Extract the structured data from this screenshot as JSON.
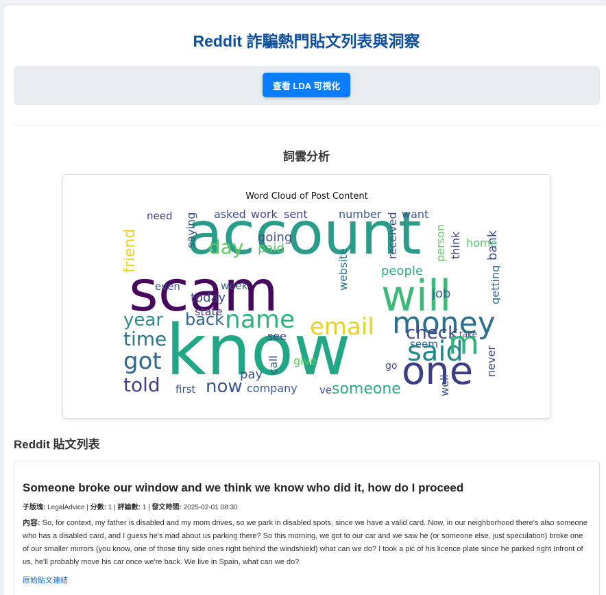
{
  "header": {
    "title": "Reddit 詐騙熱門貼文列表與洞察",
    "lda_button_label": "查看 LDA 可視化"
  },
  "wordcloud_section": {
    "title": "詞雲分析",
    "chart_title": "Word Cloud of Post Content",
    "words": [
      {
        "text": "account",
        "color": "#2a9d8a"
      },
      {
        "text": "know",
        "color": "#21a785"
      },
      {
        "text": "scam",
        "color": "#46085c"
      },
      {
        "text": "will",
        "color": "#40b87a"
      },
      {
        "text": "one",
        "color": "#3b3e84"
      },
      {
        "text": "money",
        "color": "#2a6f8e"
      },
      {
        "text": "email",
        "color": "#e4d22c"
      },
      {
        "text": "name",
        "color": "#2fb27c"
      },
      {
        "text": "said",
        "color": "#25868d"
      },
      {
        "text": "got",
        "color": "#31678e"
      },
      {
        "text": "told",
        "color": "#433d84"
      },
      {
        "text": "time",
        "color": "#2b768e"
      },
      {
        "text": "year",
        "color": "#2c8c8c"
      },
      {
        "text": "day",
        "color": "#5ec962"
      },
      {
        "text": "back",
        "color": "#33638d"
      },
      {
        "text": "check",
        "color": "#3f4889"
      },
      {
        "text": "now",
        "color": "#3a548c"
      },
      {
        "text": "someone",
        "color": "#2fa882"
      },
      {
        "text": "company",
        "color": "#38598c"
      },
      {
        "text": "friend",
        "color": "#e9d326"
      },
      {
        "text": "website",
        "color": "#2c718e"
      },
      {
        "text": "people",
        "color": "#31a883"
      },
      {
        "text": "bank",
        "color": "#3e4a89"
      },
      {
        "text": "home",
        "color": "#52c569"
      },
      {
        "text": "today",
        "color": "#3f4789"
      },
      {
        "text": "state",
        "color": "#443b84"
      },
      {
        "text": "paid",
        "color": "#5cc863"
      },
      {
        "text": "going",
        "color": "#3d4d8a"
      },
      {
        "text": "asked",
        "color": "#3e4c8a"
      },
      {
        "text": "work",
        "color": "#404688"
      },
      {
        "text": "sent",
        "color": "#42408a"
      },
      {
        "text": "number",
        "color": "#38588c"
      },
      {
        "text": "want",
        "color": "#3b528b"
      },
      {
        "text": "need",
        "color": "#414287"
      },
      {
        "text": "saying",
        "color": "#3c508b"
      },
      {
        "text": "pay",
        "color": "#3a538b"
      },
      {
        "text": "call",
        "color": "#3a548c"
      },
      {
        "text": "see",
        "color": "#404387"
      },
      {
        "text": "job",
        "color": "#33648d"
      },
      {
        "text": "think",
        "color": "#404588"
      },
      {
        "text": "received",
        "color": "#3b518b"
      },
      {
        "text": "person",
        "color": "#5dc963"
      },
      {
        "text": "getting",
        "color": "#2e6e8e"
      },
      {
        "text": "never",
        "color": "#3d4d8a"
      },
      {
        "text": "give",
        "color": "#5ec962"
      },
      {
        "text": "first",
        "color": "#3c508b"
      },
      {
        "text": "even",
        "color": "#3a548c"
      },
      {
        "text": "week",
        "color": "#33628d"
      },
      {
        "text": "seem",
        "color": "#31678e"
      },
      {
        "text": "go",
        "color": "#404588"
      },
      {
        "text": "ve",
        "color": "#3f4889"
      },
      {
        "text": "m",
        "color": "#2fb47c"
      },
      {
        "text": "well",
        "color": "#3b528b"
      },
      {
        "text": "take",
        "color": "#3d4e8a"
      }
    ]
  },
  "posts_section": {
    "title": "Reddit 貼文列表",
    "posts": [
      {
        "title": "Someone broke our window and we think we know who did it, how do I proceed",
        "subreddit_label": "子版塊:",
        "subreddit": "LegalAdvice",
        "score_label": "分數:",
        "score": "1",
        "comments_label": "評論數:",
        "comments": "1",
        "time_label": "發文時間:",
        "time": "2025-02-01 08:30",
        "separator": "|",
        "content_label": "內容:",
        "content": "So, for context, my father is disabled and my mom drives, so we park in disabled spots, since we have a valid card. Now, in our neighborhood there's also someone who has a disabled card, and I guess he's mad about us parking there? So this morning, we got to our car and we saw he (or someone else, just speculation) broke one of our smaller mirrors (you know, one of those tiny side ones right behind the windshield) what can we do? I took a pic of his licence plate since he parked right Infront of us, he'll probably move his car once we're back. We live in Spain, what can we do?",
        "link_label": "原始貼文連結"
      }
    ]
  },
  "colors": {
    "title_blue": "#0d4f9c",
    "button_blue": "#0a7cff",
    "link_blue": "#0a66d9"
  }
}
